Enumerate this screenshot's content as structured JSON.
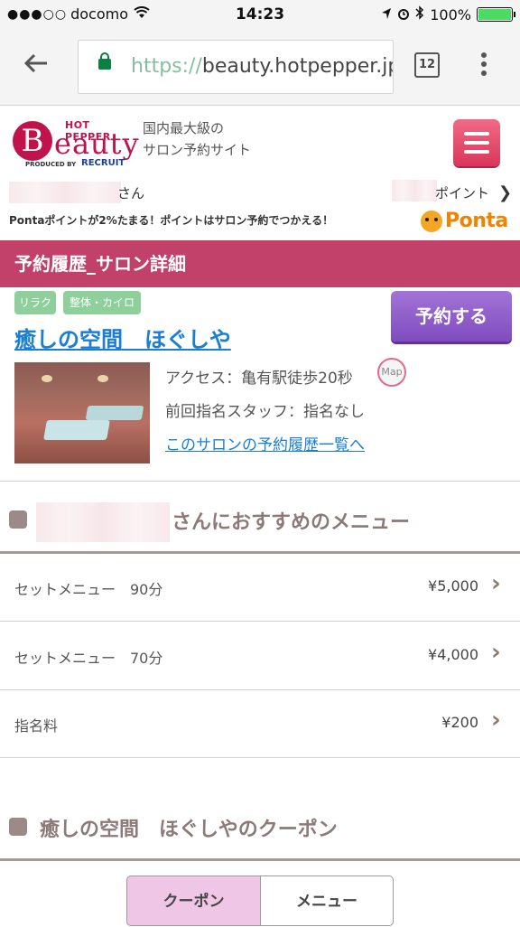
{
  "status_bar": {
    "signal": "●●●○○",
    "carrier": "docomo",
    "wifi_icon": "wifi-icon",
    "time": "14:23",
    "icons": [
      "location-icon",
      "alarm-icon",
      "bluetooth-icon"
    ],
    "battery": "100%",
    "battery_level": 1.0
  },
  "browser": {
    "url_scheme": "https://",
    "url_host": "beauty.hotpepper.jp",
    "tab_count": "12"
  },
  "header": {
    "logo_top": "HOT PEPPER",
    "logo_letter": "B",
    "logo_rest": "eauty",
    "logo_produced": "PRODUCED BY",
    "logo_recruit": "RECRUIT",
    "tagline_1": "国内最大級の",
    "tagline_2": "サロン予約サイト"
  },
  "user": {
    "name_suffix": "さん",
    "points_label": "ポイント",
    "ponta_message": "Pontaポイントが2%たまる！ポイントはサロン予約でつかえる！",
    "ponta_logo": "Ponta"
  },
  "section_title": "予約履歴_サロン詳細",
  "salon": {
    "tags": [
      "リラク",
      "整体・カイロ"
    ],
    "name": "癒しの空間　ほぐしや",
    "reserve_label": "予約する",
    "access": "アクセス：亀有駅徒歩20秒",
    "map_label": "Map",
    "staff": "前回指名スタッフ：指名なし",
    "history_link": "このサロンの予約履歴一覧へ"
  },
  "recommend": {
    "title_suffix": "さんにおすすめのメニュー",
    "items": [
      {
        "label": "セットメニュー　90分",
        "price": "¥5,000"
      },
      {
        "label": "セットメニュー　70分",
        "price": "¥4,000"
      },
      {
        "label": "指名料",
        "price": "¥200"
      }
    ]
  },
  "coupon": {
    "title": "癒しの空間　ほぐしやのクーポン",
    "tabs": [
      "クーポン",
      "メニュー"
    ]
  },
  "colors": {
    "brand": "#c0134c",
    "section_bar": "#c2416a",
    "reserve": "#8b58c9",
    "link": "#1a7fd4",
    "tag": "#8fcf9c"
  }
}
